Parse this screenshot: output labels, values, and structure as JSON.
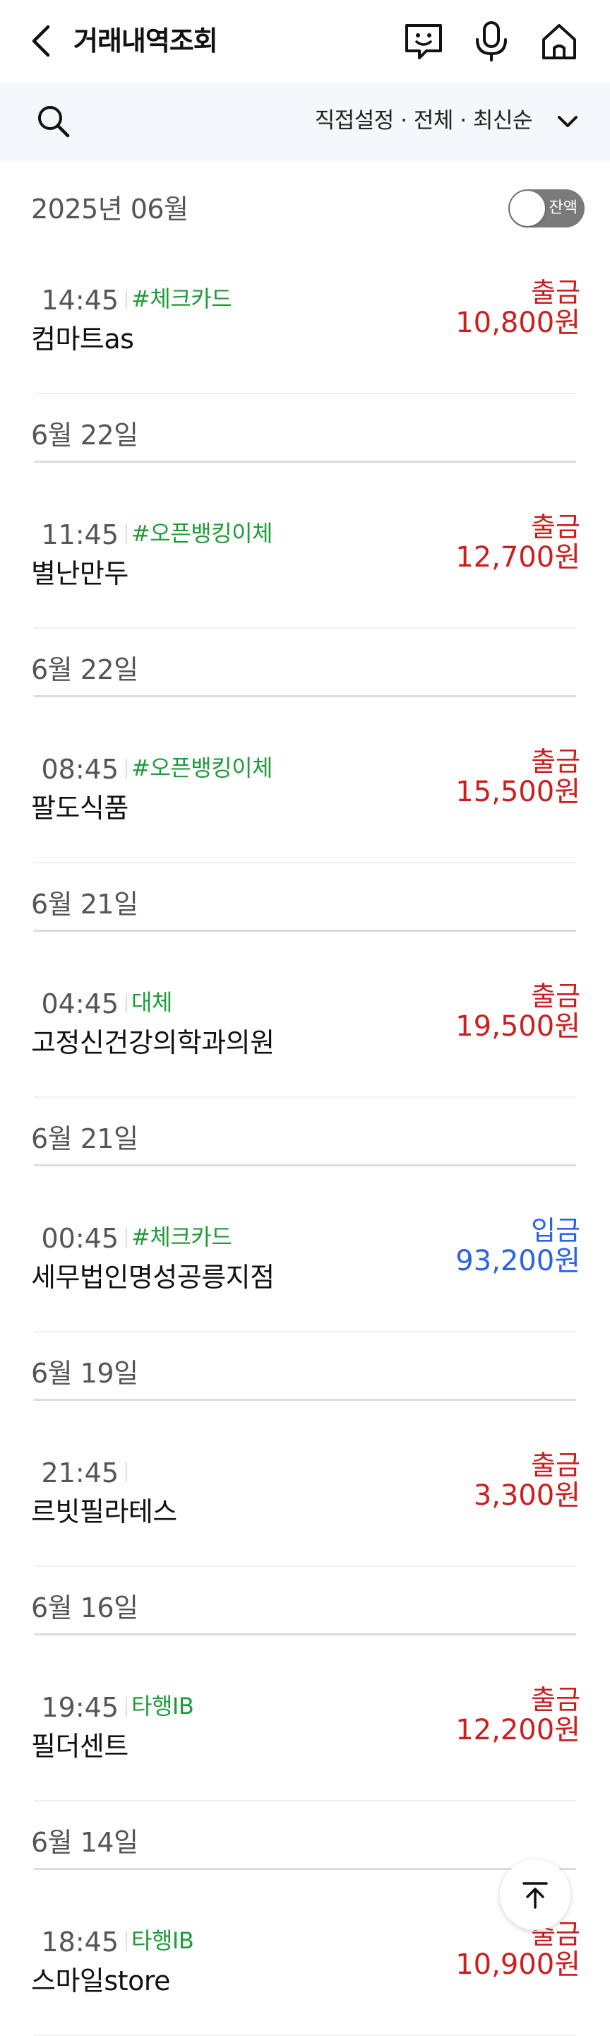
{
  "header": {
    "title": "거래내역조회",
    "icons": [
      "back-icon",
      "chat-icon",
      "mic-icon",
      "home-icon"
    ]
  },
  "filter": {
    "label": "직접설정 · 전체 · 최신순",
    "icons": [
      "search-icon",
      "chevron-down-icon"
    ]
  },
  "month": {
    "label": "2025년 06월",
    "balance_toggle_label": "잔액",
    "balance_toggle_on": false
  },
  "colors": {
    "withdraw": "#cc1f1f",
    "deposit": "#2b63e6",
    "tag": "#1f9b3a"
  },
  "groups": [
    {
      "date": "",
      "txns": [
        {
          "time": "14:45",
          "tag": "#체크카드",
          "merchant": "컴마트as",
          "kind": "출금",
          "amount": "10,800원",
          "type": "withdraw"
        }
      ]
    },
    {
      "date": "6월 22일",
      "txns": [
        {
          "time": "11:45",
          "tag": "#오픈뱅킹이체",
          "merchant": "별난만두",
          "kind": "출금",
          "amount": "12,700원",
          "type": "withdraw"
        }
      ]
    },
    {
      "date": "6월 22일",
      "txns": [
        {
          "time": "08:45",
          "tag": "#오픈뱅킹이체",
          "merchant": "팔도식품",
          "kind": "출금",
          "amount": "15,500원",
          "type": "withdraw"
        }
      ]
    },
    {
      "date": "6월 21일",
      "txns": [
        {
          "time": "04:45",
          "tag": "대체",
          "merchant": "고정신건강의학과의원",
          "kind": "출금",
          "amount": "19,500원",
          "type": "withdraw"
        }
      ]
    },
    {
      "date": "6월 21일",
      "txns": [
        {
          "time": "00:45",
          "tag": "#체크카드",
          "merchant": "세무법인명성공릉지점",
          "kind": "입금",
          "amount": "93,200원",
          "type": "deposit"
        }
      ]
    },
    {
      "date": "6월 19일",
      "txns": [
        {
          "time": "21:45",
          "tag": "",
          "merchant": "르빗필라테스",
          "kind": "출금",
          "amount": "3,300원",
          "type": "withdraw"
        }
      ]
    },
    {
      "date": "6월 16일",
      "txns": [
        {
          "time": "19:45",
          "tag": "타행IB",
          "merchant": "필더센트",
          "kind": "출금",
          "amount": "12,200원",
          "type": "withdraw"
        }
      ]
    },
    {
      "date": "6월 14일",
      "txns": [
        {
          "time": "18:45",
          "tag": "타행IB",
          "merchant": "스마일store",
          "kind": "출금",
          "amount": "10,900원",
          "type": "withdraw"
        }
      ]
    }
  ],
  "scroll_top_icon": "arrow-up-icon"
}
